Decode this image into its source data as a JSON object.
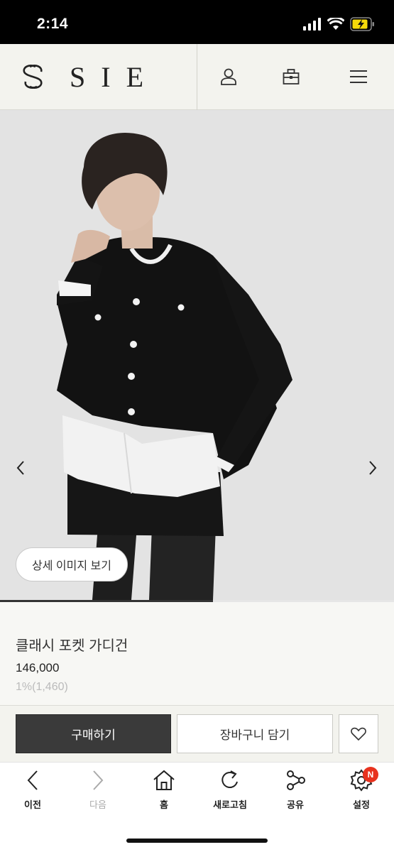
{
  "status_bar": {
    "time": "2:14"
  },
  "header": {
    "logo_text": "SIE",
    "icons": [
      "user-icon",
      "bag-icon",
      "menu-icon"
    ]
  },
  "hero": {
    "detail_button": "상세 이미지 보기",
    "slide_progress": 0.54
  },
  "product": {
    "name": "클래시 포켓 가디건",
    "price": "146,000",
    "points": "1%(1,460)"
  },
  "actions": {
    "buy_label": "구매하기",
    "cart_label": "장바구니 담기"
  },
  "bottom_nav": {
    "items": [
      {
        "label": "이전",
        "icon": "chevron-left-icon"
      },
      {
        "label": "다음",
        "icon": "chevron-right-icon"
      },
      {
        "label": "홈",
        "icon": "home-icon"
      },
      {
        "label": "새로고침",
        "icon": "refresh-icon"
      },
      {
        "label": "공유",
        "icon": "share-icon"
      },
      {
        "label": "설정",
        "icon": "gear-icon",
        "badge": "N"
      }
    ]
  },
  "colors": {
    "accent_dark": "#3a3a3a",
    "badge_red": "#e8321e",
    "battery_yellow": "#f5d90a"
  }
}
